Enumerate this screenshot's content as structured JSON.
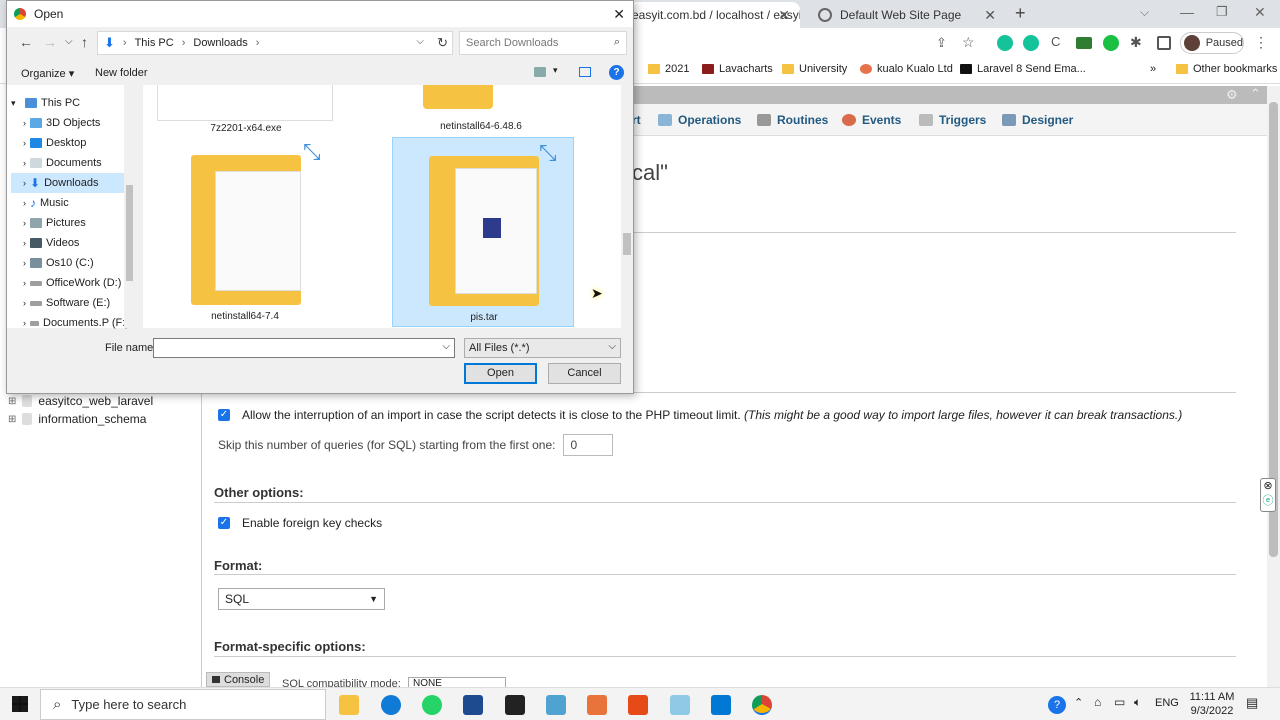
{
  "browser": {
    "tabs": [
      {
        "label": "easyit.com.bd / localhost / easyit"
      },
      {
        "label": "Default Web Site Page"
      }
    ],
    "profile": "Paused",
    "bookmarks": [
      "2021",
      "Lavacharts",
      "University",
      "kualo Kualo Ltd",
      "Laravel 8 Send Ema...",
      "Other bookmarks"
    ]
  },
  "pma": {
    "db_tree": [
      "easyitco_web_laravel",
      "information_schema"
    ],
    "tabs": [
      "rt",
      "Operations",
      "Routines",
      "Events",
      "Triggers",
      "Designer"
    ],
    "heading_fragment": "cal\"",
    "options": {
      "interrupt_label": "Allow the interruption of an import in case the script detects it is close to the PHP timeout limit.",
      "interrupt_note": "(This might be a good way to import large files, however it can break transactions.)",
      "skip_label": "Skip this number of queries (for SQL) starting from the first one:",
      "skip_value": "0"
    },
    "other_options_title": "Other options:",
    "foreign_key_label": "Enable foreign key checks",
    "format_title": "Format:",
    "format_value": "SQL",
    "format_specific_title": "Format-specific options:",
    "console_label": "Console",
    "sql_compat_label": "SQL compatibility mode:",
    "sql_compat_value": "NONE"
  },
  "dialog": {
    "title": "Open",
    "breadcrumb": [
      "This PC",
      "Downloads"
    ],
    "search_placeholder": "Search Downloads",
    "organize": "Organize ▾",
    "new_folder": "New folder",
    "nav_items": [
      {
        "label": "This PC"
      },
      {
        "label": "3D Objects"
      },
      {
        "label": "Desktop"
      },
      {
        "label": "Documents"
      },
      {
        "label": "Downloads"
      },
      {
        "label": "Music"
      },
      {
        "label": "Pictures"
      },
      {
        "label": "Videos"
      },
      {
        "label": "Os10 (C:)"
      },
      {
        "label": "OfficeWork (D:)"
      },
      {
        "label": "Software (E:)"
      },
      {
        "label": "Documents.P (F:)"
      }
    ],
    "files": [
      "7z2201-x64.exe",
      "netinstall64-6.48.6",
      "netinstall64-7.4",
      "pis.tar"
    ],
    "filename_label": "File name:",
    "filename_value": "",
    "filetype": "All Files (*.*)",
    "open_label": "Open",
    "cancel_label": "Cancel"
  },
  "taskbar": {
    "search_placeholder": "Type here to search",
    "lang": "ENG",
    "time": "11:11 AM",
    "date": "9/3/2022"
  }
}
